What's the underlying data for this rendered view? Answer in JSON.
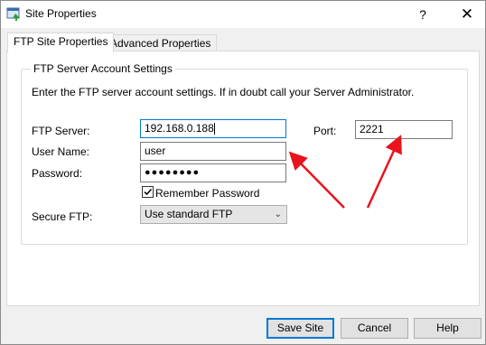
{
  "window": {
    "title": "Site Properties",
    "help_glyph": "?",
    "close_glyph": "✕"
  },
  "tabs": [
    {
      "label": "FTP Site Properties",
      "active": true
    },
    {
      "label": "Advanced Properties",
      "active": false
    }
  ],
  "group": {
    "legend": "FTP Server Account Settings",
    "instructions": "Enter the FTP server account settings. If in doubt call your Server Administrator."
  },
  "form": {
    "ftp_server_label": "FTP Server:",
    "ftp_server_value": "192.168.0.188",
    "port_label": "Port:",
    "port_value": "2221",
    "username_label": "User Name:",
    "username_value": "user",
    "password_label": "Password:",
    "password_value": "●●●●●●●●",
    "remember_label": "Remember Password",
    "remember_checked": true,
    "secure_label": "Secure FTP:",
    "secure_value": "Use standard FTP"
  },
  "buttons": {
    "save": "Save Site",
    "cancel": "Cancel",
    "help": "Help"
  },
  "colors": {
    "accent": "#0078d7",
    "annotation_arrow": "#e8131d"
  }
}
